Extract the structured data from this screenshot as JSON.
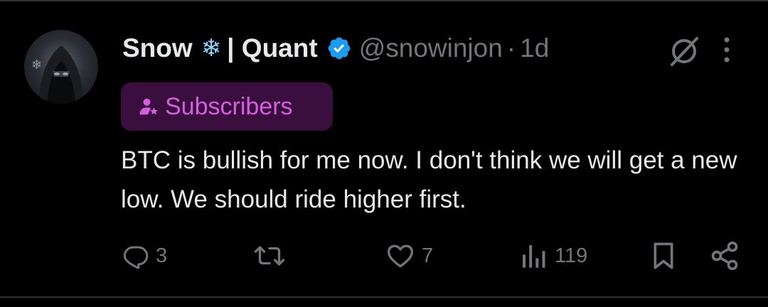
{
  "tweet": {
    "display_name_part1": "Snow",
    "snow_emoji": "❄",
    "display_name_part2": "| Quant",
    "handle": "@snowinjon",
    "separator": "·",
    "time": "1d",
    "badge_label": "Subscribers",
    "text": "BTC is bullish for me now. I don't think we will get a new low. We should ride higher first."
  },
  "actions": {
    "replies": "3",
    "likes": "7",
    "views": "119"
  },
  "icons": {
    "verified": "verified-badge-icon",
    "grok": "grok-icon",
    "more": "more-vertical-icon",
    "badge": "subscriber-icon",
    "reply": "reply-icon",
    "retweet": "retweet-icon",
    "like": "heart-icon",
    "views": "views-icon",
    "bookmark": "bookmark-icon",
    "share": "share-icon"
  },
  "colors": {
    "background": "#000000",
    "text": "#e7e9ea",
    "secondary": "#71767b",
    "verified": "#1d9bf0",
    "badge_bg": "#3a0f3d",
    "badge_text": "#d65ee0"
  }
}
